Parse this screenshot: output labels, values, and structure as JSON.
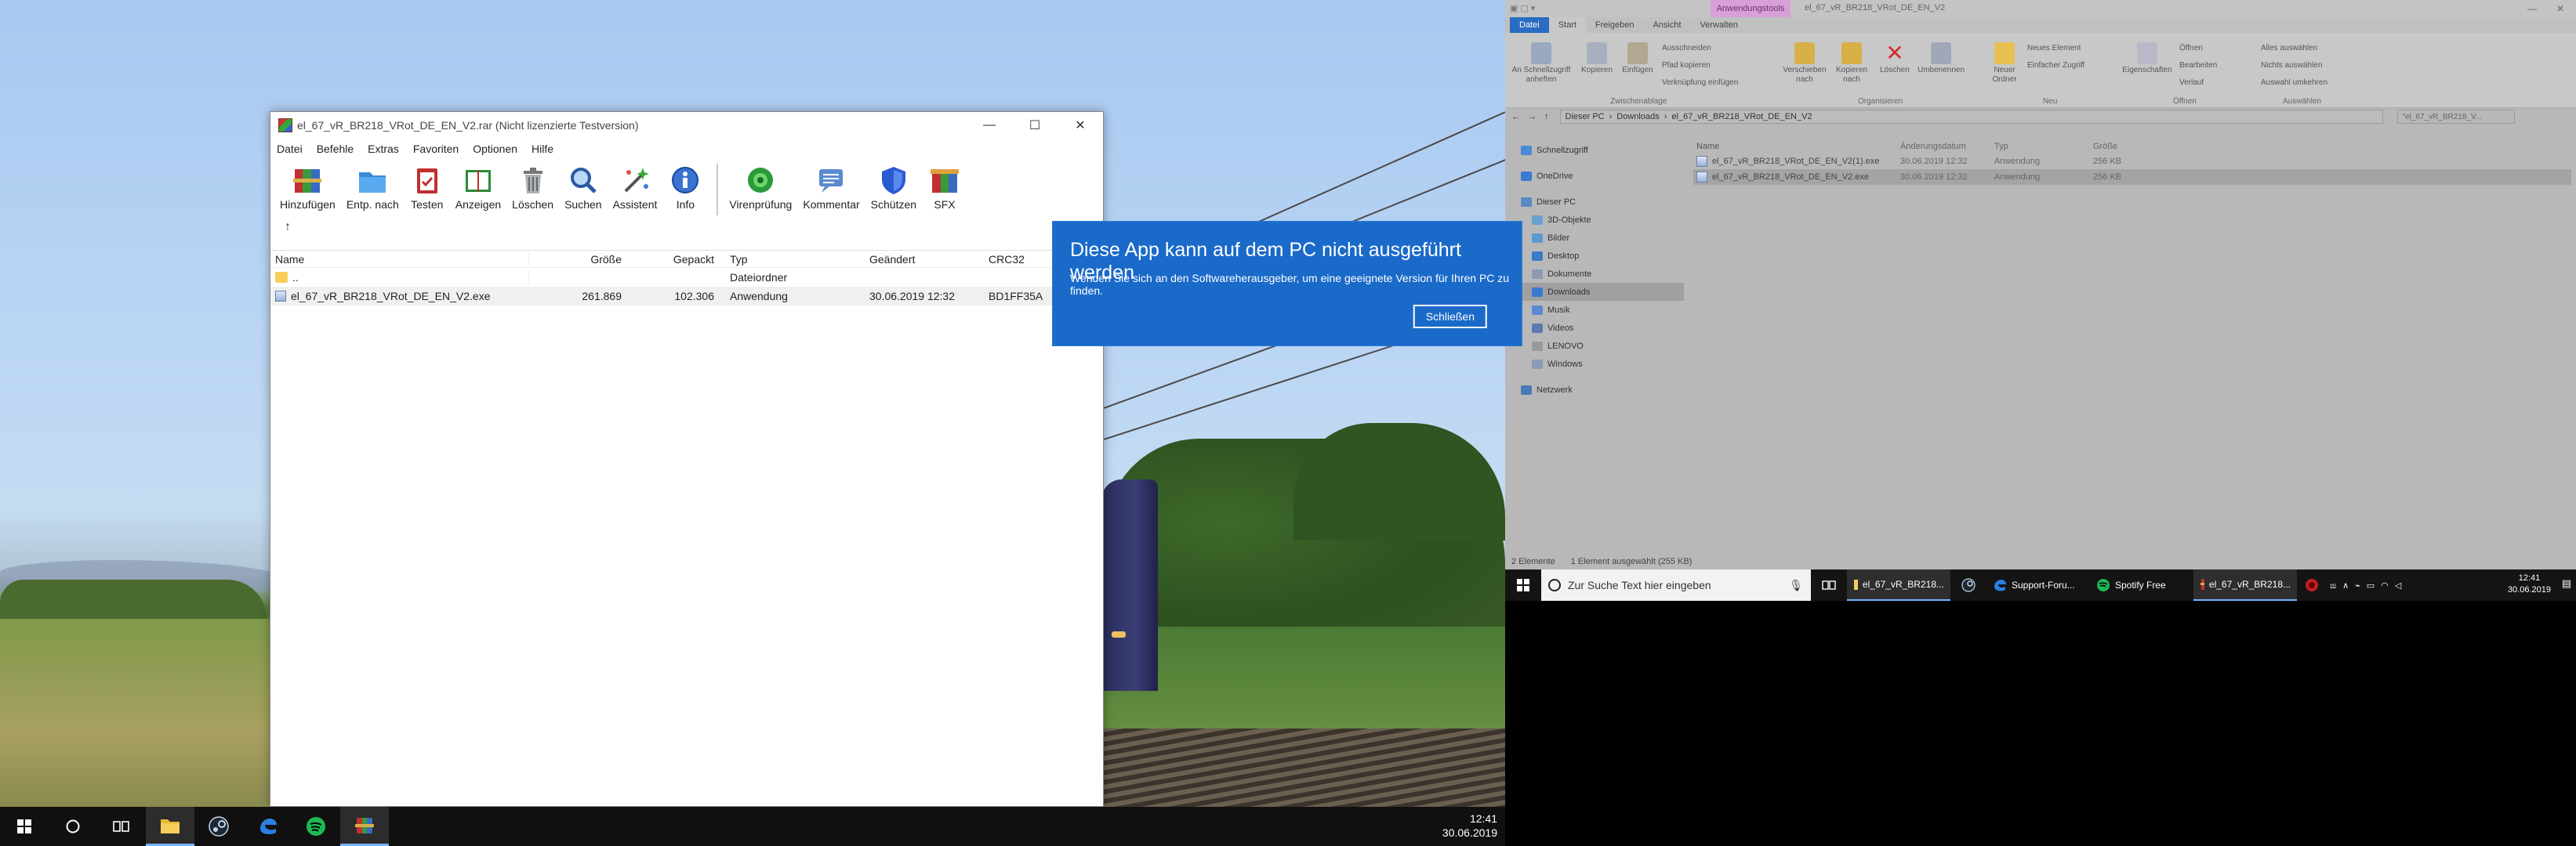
{
  "winrar": {
    "title": "el_67_vR_BR218_VRot_DE_EN_V2.rar (Nicht lizenzierte Testversion)",
    "menu": [
      "Datei",
      "Befehle",
      "Extras",
      "Favoriten",
      "Optionen",
      "Hilfe"
    ],
    "toolbar": [
      "Hinzufügen",
      "Entp. nach",
      "Testen",
      "Anzeigen",
      "Löschen",
      "Suchen",
      "Assistent",
      "Info",
      "Virenprüfung",
      "Kommentar",
      "Schützen",
      "SFX"
    ],
    "up_arrow": "↑",
    "columns": {
      "name": "Name",
      "size": "Größe",
      "packed": "Gepackt",
      "type": "Typ",
      "modified": "Geändert",
      "crc": "CRC32"
    },
    "rows": [
      {
        "name": "..",
        "size": "",
        "packed": "",
        "type": "Dateiordner",
        "modified": "",
        "crc": ""
      },
      {
        "name": "el_67_vR_BR218_VRot_DE_EN_V2.exe",
        "size": "261.869",
        "packed": "102.306",
        "type": "Anwendung",
        "modified": "30.06.2019 12:32",
        "crc": "BD1FF35A"
      }
    ],
    "controls": {
      "minimize": "—",
      "maximize": "☐",
      "close": "✕"
    }
  },
  "taskbar_left": {
    "time": "12:41",
    "date": "30.06.2019"
  },
  "explorer": {
    "context_tab": "Anwendungstools",
    "title": "el_67_vR_BR218_VRot_DE_EN_V2",
    "tabs": [
      "Datei",
      "Start",
      "Freigeben",
      "Ansicht",
      "Verwalten"
    ],
    "ribbon": {
      "pin": "An Schnellzugriff anheften",
      "copy": "Kopieren",
      "paste": "Einfügen",
      "cut": "Ausschneiden",
      "copy_path": "Pfad kopieren",
      "paste_shortcut": "Verknüpfung einfügen",
      "group_clipboard": "Zwischenablage",
      "move_to": "Verschieben nach",
      "copy_to": "Kopieren nach",
      "delete": "Löschen",
      "rename": "Umbenennen",
      "group_organize": "Organisieren",
      "new_folder": "Neuer Ordner",
      "new_item": "Neues Element",
      "easy_access": "Einfacher Zugriff",
      "group_new": "Neu",
      "properties": "Eigenschaften",
      "open": "Öffnen",
      "edit": "Bearbeiten",
      "history": "Verlauf",
      "group_open": "Öffnen",
      "select_all": "Alles auswählen",
      "select_none": "Nichts auswählen",
      "invert": "Auswahl umkehren",
      "group_select": "Auswählen"
    },
    "address": [
      "Dieser PC",
      "Downloads",
      "el_67_vR_BR218_VRot_DE_EN_V2"
    ],
    "search_placeholder": "\"el_67_vR_BR218_V...",
    "nav": [
      "Schnellzugriff",
      "OneDrive",
      "Dieser PC",
      "3D-Objekte",
      "Bilder",
      "Desktop",
      "Dokumente",
      "Downloads",
      "Musik",
      "Videos",
      "LENOVO",
      "Windows",
      "Netzwerk"
    ],
    "columns": {
      "name": "Name",
      "modified": "Änderungsdatum",
      "type": "Typ",
      "size": "Größe"
    },
    "files": [
      {
        "name": "el_67_vR_BR218_VRot_DE_EN_V2(1).exe",
        "modified": "30.06.2019 12:32",
        "type": "Anwendung",
        "size": "256 KB"
      },
      {
        "name": "el_67_vR_BR218_VRot_DE_EN_V2.exe",
        "modified": "30.06.2019 12:32",
        "type": "Anwendung",
        "size": "256 KB"
      }
    ],
    "status_count": "2 Elemente",
    "status_selected": "1 Element ausgewählt (255 KB)"
  },
  "dialog": {
    "title": "Diese App kann auf dem PC nicht ausgeführt werden",
    "message": "Wenden Sie sich an den Softwareherausgeber, um eine geeignete Version für Ihren PC zu finden.",
    "close": "Schließen"
  },
  "taskbar_right": {
    "search_placeholder": "Zur Suche Text hier eingeben",
    "apps": [
      "el_67_vR_BR218...",
      "Support-Foru...",
      "Spotify Free",
      "el_67_vR_BR218..."
    ],
    "time": "12:41",
    "date": "30.06.2019"
  },
  "colors": {
    "dialog_blue": "#1a6ac9",
    "accent": "#77b4ff",
    "spotify": "#1db954"
  }
}
